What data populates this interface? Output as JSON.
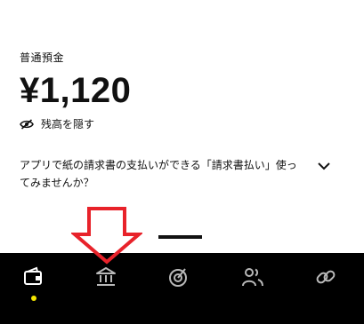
{
  "account": {
    "label": "普通預金",
    "balance": "¥1,120",
    "hide_label": "残高を隠す"
  },
  "promo": {
    "text": "アプリで紙の請求書の支払いができる「請求書払い」使ってみませんか？"
  },
  "tabs": [
    {
      "icon": "wallet-icon",
      "active": true
    },
    {
      "icon": "bank-icon",
      "active": false
    },
    {
      "icon": "target-icon",
      "active": false
    },
    {
      "icon": "people-icon",
      "active": false
    },
    {
      "icon": "link-icon",
      "active": false
    }
  ],
  "colors": {
    "tabbar_bg": "#000000",
    "tab_icon_active": "#ffffff",
    "tab_icon_inactive": "#b8b8b8",
    "active_dot": "#f5e600",
    "annotation_arrow": "#e8222a"
  }
}
